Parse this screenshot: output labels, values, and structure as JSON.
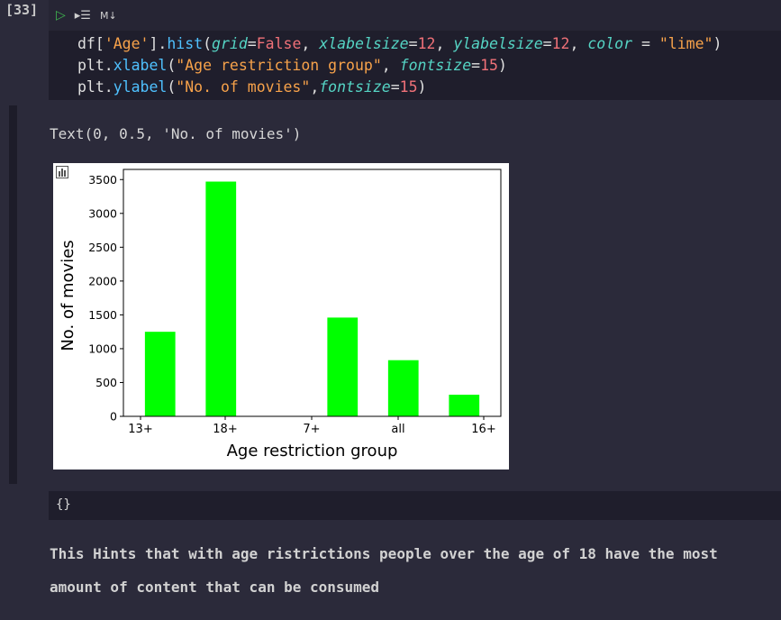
{
  "cell": {
    "execution_count": "[33]",
    "toolbar": {
      "run_icon": "▷",
      "split_icon": "▸☰",
      "md_label": "M↓"
    }
  },
  "code_lines": [
    [
      {
        "t": "df[",
        "c": "default"
      },
      {
        "t": "'Age'",
        "c": "str"
      },
      {
        "t": "].",
        "c": "default"
      },
      {
        "t": "hist",
        "c": "func"
      },
      {
        "t": "(",
        "c": "punc"
      },
      {
        "t": "grid",
        "c": "kw"
      },
      {
        "t": "=",
        "c": "punc"
      },
      {
        "t": "False",
        "c": "num"
      },
      {
        "t": ", ",
        "c": "punc"
      },
      {
        "t": "xlabelsize",
        "c": "kw"
      },
      {
        "t": "=",
        "c": "punc"
      },
      {
        "t": "12",
        "c": "num"
      },
      {
        "t": ", ",
        "c": "punc"
      },
      {
        "t": "ylabelsize",
        "c": "kw"
      },
      {
        "t": "=",
        "c": "punc"
      },
      {
        "t": "12",
        "c": "num"
      },
      {
        "t": ", ",
        "c": "punc"
      },
      {
        "t": "color",
        "c": "kw"
      },
      {
        "t": " = ",
        "c": "punc"
      },
      {
        "t": "\"lime\"",
        "c": "str"
      },
      {
        "t": ")",
        "c": "punc"
      }
    ],
    [
      {
        "t": "plt.",
        "c": "default"
      },
      {
        "t": "xlabel",
        "c": "func"
      },
      {
        "t": "(",
        "c": "punc"
      },
      {
        "t": "\"Age restriction group\"",
        "c": "str"
      },
      {
        "t": ", ",
        "c": "punc"
      },
      {
        "t": "fontsize",
        "c": "kw"
      },
      {
        "t": "=",
        "c": "punc"
      },
      {
        "t": "15",
        "c": "num"
      },
      {
        "t": ")",
        "c": "punc"
      }
    ],
    [
      {
        "t": "plt.",
        "c": "default"
      },
      {
        "t": "ylabel",
        "c": "func"
      },
      {
        "t": "(",
        "c": "punc"
      },
      {
        "t": "\"No. of movies\"",
        "c": "str"
      },
      {
        "t": ",",
        "c": "punc"
      },
      {
        "t": "fontsize",
        "c": "kw"
      },
      {
        "t": "=",
        "c": "punc"
      },
      {
        "t": "15",
        "c": "num"
      },
      {
        "t": ")",
        "c": "punc"
      }
    ]
  ],
  "output": {
    "text_repr": "Text(0, 0.5, 'No. of movies')",
    "json_placeholder": "{}"
  },
  "chart_data": {
    "type": "bar",
    "categories": [
      "13+",
      "18+",
      "",
      "7+",
      "all",
      "16+"
    ],
    "tick_labels": [
      "13+",
      "18+",
      "7+",
      "all",
      "16+"
    ],
    "values": [
      1250,
      3470,
      0,
      1460,
      830,
      320
    ],
    "xlabel": "Age restriction group",
    "ylabel": "No. of movies",
    "yticks": [
      0,
      500,
      1000,
      1500,
      2000,
      2500,
      3000,
      3500
    ],
    "ylim": [
      0,
      3650
    ],
    "color": "#00ff00",
    "grid": false
  },
  "markdown": {
    "text": "This Hints that with age ristrictions people over the age of 18 have the most amount of content that can be consumed"
  },
  "colors": {
    "bar": "#00ff00",
    "background": "#2b2a3a"
  }
}
